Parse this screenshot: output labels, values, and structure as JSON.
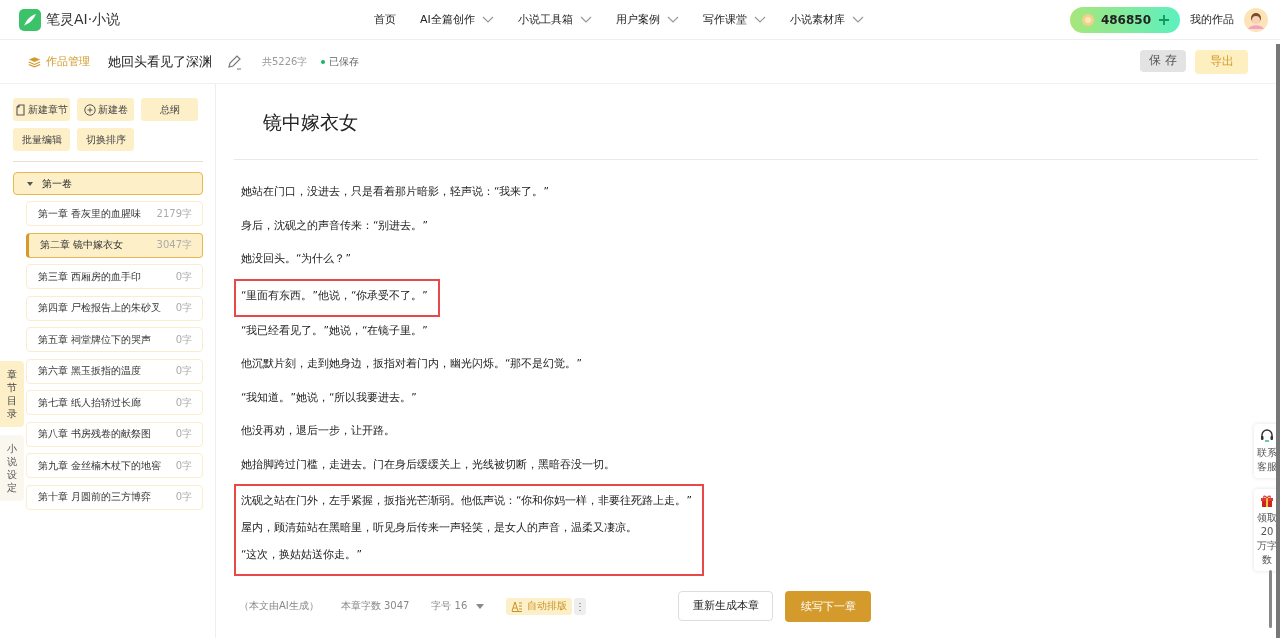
{
  "header": {
    "brand": "笔灵AI·小说",
    "nav": [
      {
        "label": "首页",
        "dropdown": false
      },
      {
        "label": "AI全篇创作",
        "dropdown": true
      },
      {
        "label": "小说工具箱",
        "dropdown": true
      },
      {
        "label": "用户案例",
        "dropdown": true
      },
      {
        "label": "写作课堂",
        "dropdown": true
      },
      {
        "label": "小说素材库",
        "dropdown": true
      }
    ],
    "credits": "486850",
    "my_works": "我的作品"
  },
  "toolbar": {
    "manage": "作品管理",
    "book_title": "她回头看见了深渊",
    "word_count": "共5226字",
    "save_status": "已保存",
    "buttons": [
      {
        "label": "保 存",
        "kind": "grey"
      },
      {
        "label": "导出",
        "kind": "yellow"
      }
    ]
  },
  "sidebar": {
    "actions": [
      {
        "label": "新建章节",
        "kind": "chapter"
      },
      {
        "label": "新建卷",
        "kind": "volume"
      },
      {
        "label": "总纲",
        "kind": "plain"
      },
      {
        "label": "批量编辑",
        "kind": "plain"
      },
      {
        "label": "切换排序",
        "kind": "plain"
      }
    ],
    "volumes": [
      {
        "label": "第一卷",
        "expanded": true,
        "chapters": [
          {
            "title": "第一章 香灰里的血腥味",
            "count": "2179字",
            "selected": false
          },
          {
            "title": "第二章 镜中嫁衣女",
            "count": "3047字",
            "selected": true
          },
          {
            "title": "第三章 西厢房的血手印",
            "count": "0字",
            "selected": false
          },
          {
            "title": "第四章 尸检报告上的朱砂叉",
            "count": "0字",
            "selected": false
          },
          {
            "title": "第五章 祠堂牌位下的哭声",
            "count": "0字",
            "selected": false
          },
          {
            "title": "第六章 黑玉扳指的温度",
            "count": "0字",
            "selected": false
          },
          {
            "title": "第七章 纸人抬轿过长廊",
            "count": "0字",
            "selected": false
          },
          {
            "title": "第八章 书房残卷的献祭图",
            "count": "0字",
            "selected": false
          },
          {
            "title": "第九章 金丝楠木杖下的地窖",
            "count": "0字",
            "selected": false
          },
          {
            "title": "第十章 月圆前的三方博弈",
            "count": "0字",
            "selected": false
          }
        ]
      }
    ],
    "side_tabs": [
      {
        "label": "章节目录",
        "selected": true
      },
      {
        "label": "小说设定",
        "selected": false
      }
    ]
  },
  "editor": {
    "chapter_title": "镜中嫁衣女",
    "blocks": [
      {
        "highlighted": false,
        "paragraphs": [
          "她站在门口，没进去，只是看着那片暗影，轻声说：“我来了。”",
          "身后，沈砚之的声音传来：“别进去。”",
          "她没回头。“为什么？”"
        ]
      },
      {
        "highlighted": true,
        "paragraphs": [
          "“里面有东西。”他说，“你承受不了。”"
        ]
      },
      {
        "highlighted": false,
        "paragraphs": [
          "“我已经看见了。”她说，“在镜子里。”",
          "他沉默片刻，走到她身边，扳指对着门内，幽光闪烁。“那不是幻觉。”",
          "“我知道。”她说，“所以我要进去。”",
          "他没再劝，退后一步，让开路。",
          "她抬脚跨过门槛，走进去。门在身后缓缓关上，光线被切断，黑暗吞没一切。"
        ]
      },
      {
        "highlighted": true,
        "paragraphs": [
          "沈砚之站在门外，左手紧握，扳指光芒渐弱。他低声说：“你和你妈一样，非要往死路上走。”",
          "屋内，顾清茹站在黑暗里，听见身后传来一声轻笑，是女人的声音，温柔又凄凉。",
          "“这次，换姑姑送你走。”"
        ]
      }
    ],
    "footer": {
      "ai_note": "（本文由AI生成）",
      "chapter_count": "本章字数 3047",
      "font_size": "字号 16",
      "auto_layout": "自动排版",
      "more": "⋮",
      "regenerate": "重新生成本章",
      "continue": "续写下一章"
    }
  },
  "float": [
    {
      "label": "联系客服",
      "kind": "support"
    },
    {
      "label": "领取20万字数",
      "kind": "reward"
    }
  ]
}
